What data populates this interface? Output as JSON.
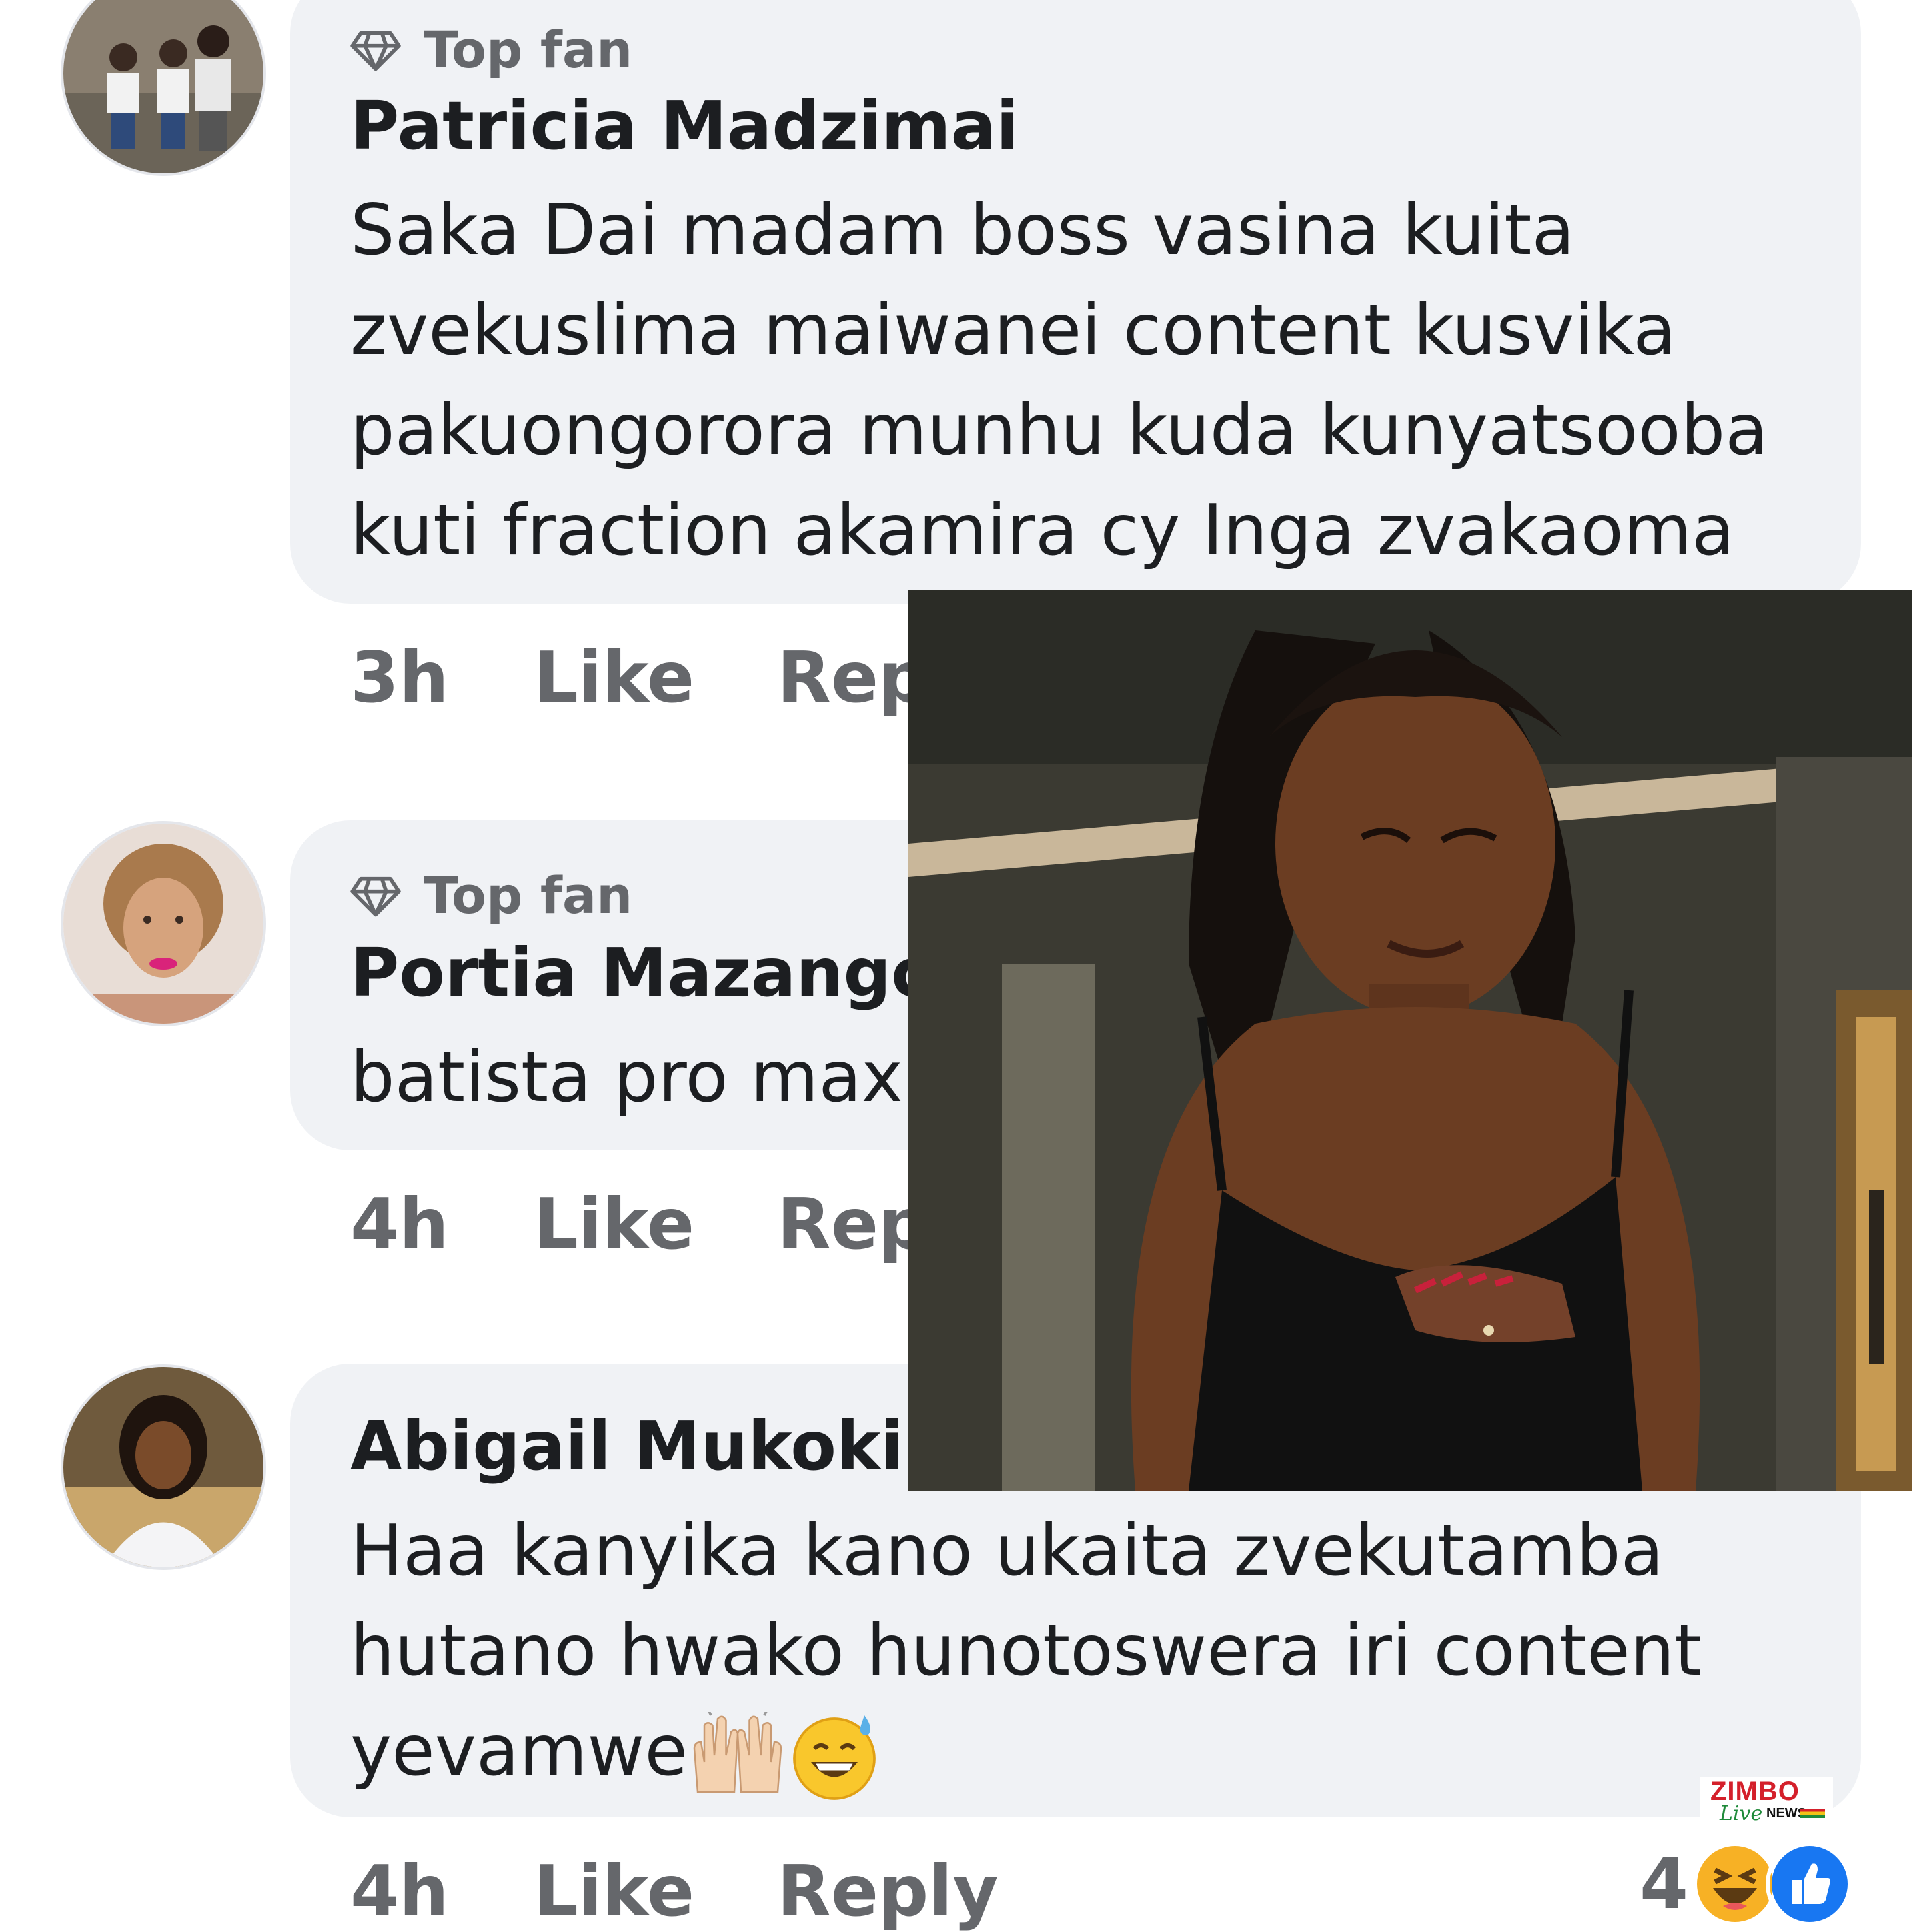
{
  "comments": [
    {
      "badge": "Top fan",
      "author": "Patricia Madzimai",
      "lines": [
        "Saka Dai madam boss vasina kuita",
        "zvekuslima maiwanei content kusvika",
        "pakuongorora munhu kuda kunyatsooba",
        "kuti fraction akamira cy Inga zvakaoma"
      ],
      "time": "3h",
      "like": "Like",
      "reply": "Reply"
    },
    {
      "badge": "Top fan",
      "author": "Portia Mazango",
      "lines": [
        "batista pro max"
      ],
      "time": "4h",
      "like": "Like",
      "reply": "Reply"
    },
    {
      "author": "Abigail Mukoki",
      "lines": [
        "Haa kanyika kano ukaita zvekutamba",
        "hutano hwako hunotoswera iri content",
        "yevamwe"
      ],
      "emojis": [
        "raised-hands-emoji",
        "sweat-smile-emoji"
      ],
      "time": "4h",
      "like": "Like",
      "reply": "Reply",
      "reaction_count": "4",
      "reactions": [
        "haha-reaction-icon",
        "like-reaction-icon"
      ]
    }
  ],
  "watermark": {
    "main": "ZIMBO",
    "script": "Live",
    "sub": "NEWS"
  },
  "colors": {
    "bubble": "#f0f2f5",
    "secondary_text": "#65676b",
    "primary_text": "#1c1e21",
    "like_blue": "#1877f2",
    "brand_red": "#d4202b"
  }
}
